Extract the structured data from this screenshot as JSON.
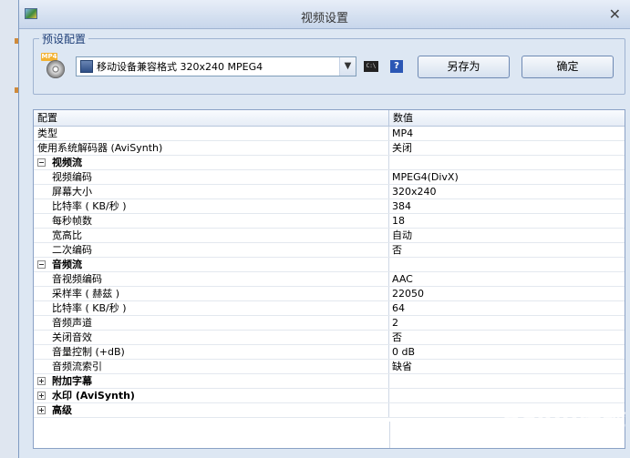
{
  "dialog": {
    "title": "视频设置",
    "close": "✕"
  },
  "preset": {
    "legend": "预设配置",
    "icon_tag": "MP4",
    "selected": "移动设备兼容格式 320x240 MPEG4",
    "cmd_icon": "C:\\",
    "help_icon": "?",
    "save_as_label": "另存为",
    "ok_label": "确定"
  },
  "grid": {
    "headers": [
      "配置",
      "数值"
    ],
    "rows": [
      {
        "name": "类型",
        "value": "MP4"
      },
      {
        "name": "使用系统解码器 (AviSynth)",
        "value": "关闭"
      },
      {
        "name": "视频流",
        "value": ""
      },
      {
        "name": "视频编码",
        "value": "MPEG4(DivX)"
      },
      {
        "name": "屏幕大小",
        "value": "320x240"
      },
      {
        "name": "比特率 ( KB/秒 )",
        "value": "384"
      },
      {
        "name": "每秒帧数",
        "value": "18"
      },
      {
        "name": "宽高比",
        "value": "自动"
      },
      {
        "name": "二次编码",
        "value": "否"
      },
      {
        "name": "音频流",
        "value": ""
      },
      {
        "name": "音视频编码",
        "value": "AAC"
      },
      {
        "name": "采样率 ( 赫兹 )",
        "value": "22050"
      },
      {
        "name": "比特率 ( KB/秒 )",
        "value": "64"
      },
      {
        "name": "音频声道",
        "value": "2"
      },
      {
        "name": "关闭音效",
        "value": "否"
      },
      {
        "name": "音量控制 (+dB)",
        "value": "0 dB"
      },
      {
        "name": "音频流索引",
        "value": "缺省"
      },
      {
        "name": "附加字幕",
        "value": ""
      },
      {
        "name": "水印 (AviSynth)",
        "value": ""
      },
      {
        "name": "高级",
        "value": ""
      }
    ]
  },
  "watermark": {
    "brand": "Baidu经验",
    "sub": "jingyan.baidu.com"
  }
}
